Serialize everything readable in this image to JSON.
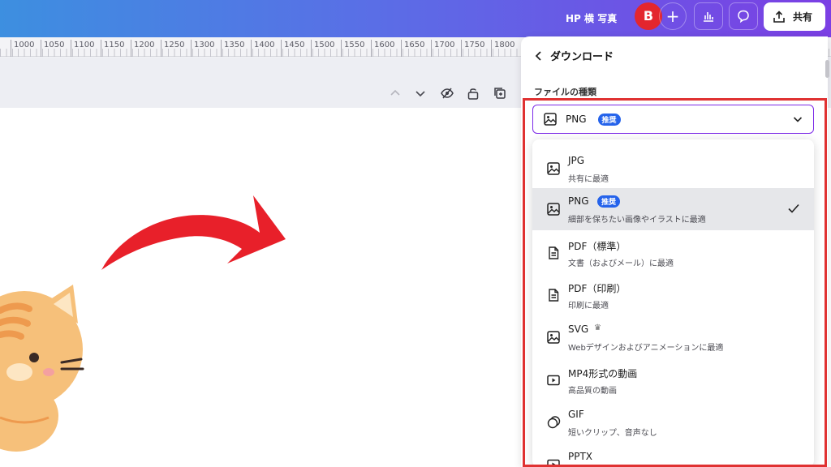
{
  "header": {
    "project_name": "HP 横 写真",
    "avatar_initial": "B",
    "share_label": "共有",
    "plus_label": "+"
  },
  "ruler": {
    "ticks": [
      "1000",
      "1050",
      "1100",
      "1150",
      "1200",
      "1250",
      "1300",
      "1350",
      "1400",
      "1450",
      "1500",
      "1550",
      "1600",
      "1650",
      "1700",
      "1750",
      "1800"
    ]
  },
  "download_panel": {
    "title": "ダウンロード",
    "file_type_label": "ファイルの種類",
    "selected_value": "PNG",
    "selected_badge": "推奨",
    "options": [
      {
        "label": "JPG",
        "desc": "共有に最適",
        "icon": "image-icon"
      },
      {
        "label": "PNG",
        "badge": "推奨",
        "desc": "細部を保ちたい画像やイラストに最適",
        "icon": "image-icon",
        "selected": true
      },
      {
        "label": "PDF（標準）",
        "desc": "文書（およびメール）に最適",
        "icon": "document-icon"
      },
      {
        "label": "PDF（印刷）",
        "desc": "印刷に最適",
        "icon": "document-icon"
      },
      {
        "label": "SVG",
        "crown": "♛",
        "desc": "Webデザインおよびアニメーションに最適",
        "icon": "image-icon"
      },
      {
        "label": "MP4形式の動画",
        "desc": "高品質の動画",
        "icon": "video-icon"
      },
      {
        "label": "GIF",
        "desc": "短いクリップ、音声なし",
        "icon": "gif-icon"
      },
      {
        "label": "PPTX",
        "desc": "",
        "icon": "presentation-icon"
      }
    ]
  },
  "colors": {
    "accent_purple": "#7d2ae8",
    "badge_blue": "#2563eb",
    "avatar_red": "#e3262e",
    "highlight_red": "#e03232",
    "arrow_red": "#e8202a",
    "cat_orange": "#f6c07a"
  }
}
